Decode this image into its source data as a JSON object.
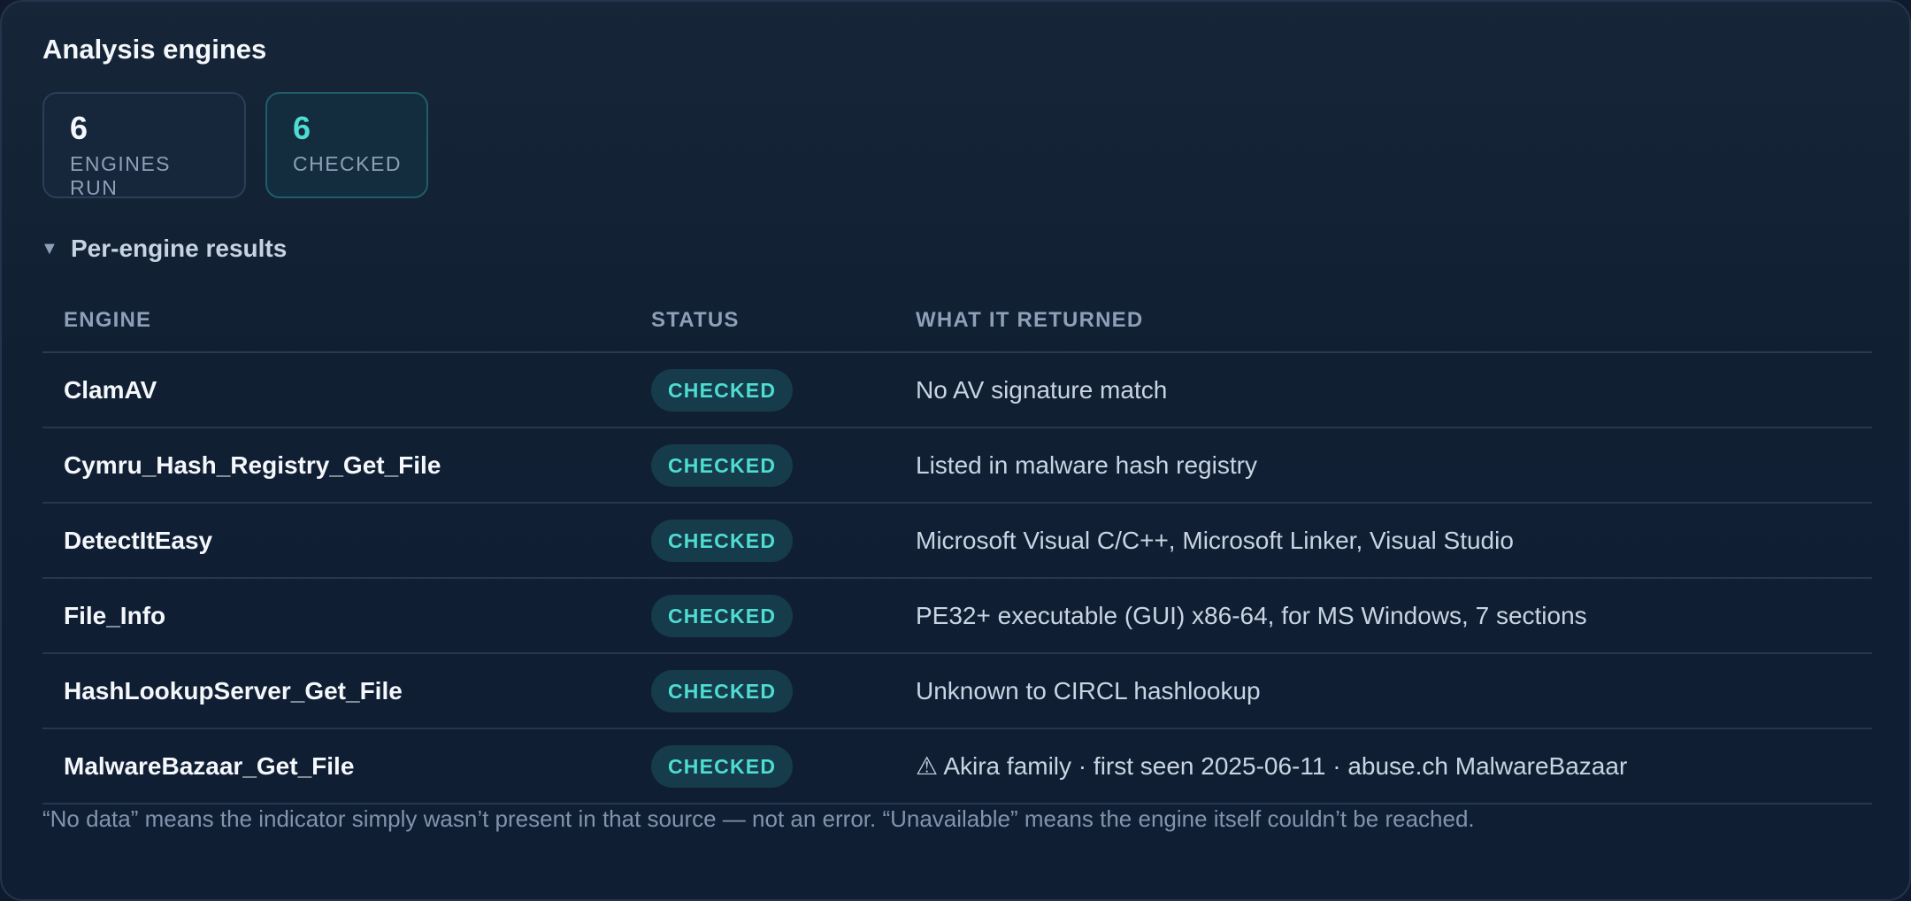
{
  "panel": {
    "title": "Analysis engines",
    "stats": {
      "total": {
        "value": "6",
        "label": "ENGINES RUN"
      },
      "checked": {
        "value": "6",
        "label": "CHECKED"
      }
    },
    "results_toggle": {
      "icon": "caret-down-icon",
      "label": "Per-engine results"
    }
  },
  "table": {
    "headers": {
      "engine": "ENGINE",
      "status": "STATUS",
      "returned": "WHAT IT RETURNED"
    },
    "rows": [
      {
        "engine": "ClamAV",
        "status": "CHECKED",
        "returned": "No AV signature match"
      },
      {
        "engine": "Cymru_Hash_Registry_Get_File",
        "status": "CHECKED",
        "returned": "Listed in malware hash registry"
      },
      {
        "engine": "DetectItEasy",
        "status": "CHECKED",
        "returned": "Microsoft Visual C/C++, Microsoft Linker, Visual Studio"
      },
      {
        "engine": "File_Info",
        "status": "CHECKED",
        "returned": "PE32+ executable (GUI) x86-64, for MS Windows, 7 sections"
      },
      {
        "engine": "HashLookupServer_Get_File",
        "status": "CHECKED",
        "returned": "Unknown to CIRCL hashlookup"
      },
      {
        "engine": "MalwareBazaar_Get_File",
        "status": "CHECKED",
        "returned": "⚠ Akira family · first seen 2025-06-11 · abuse.ch MalwareBazaar"
      }
    ]
  },
  "footnote": "“No data” means the indicator simply wasn’t present in that source — not an error. “Unavailable” means the engine itself couldn’t be reached.",
  "colors": {
    "background": "#0f1b2c",
    "accent": "#4fdcd2",
    "badge_bg": "#163b4a",
    "muted_text": "#8e9fb8"
  }
}
